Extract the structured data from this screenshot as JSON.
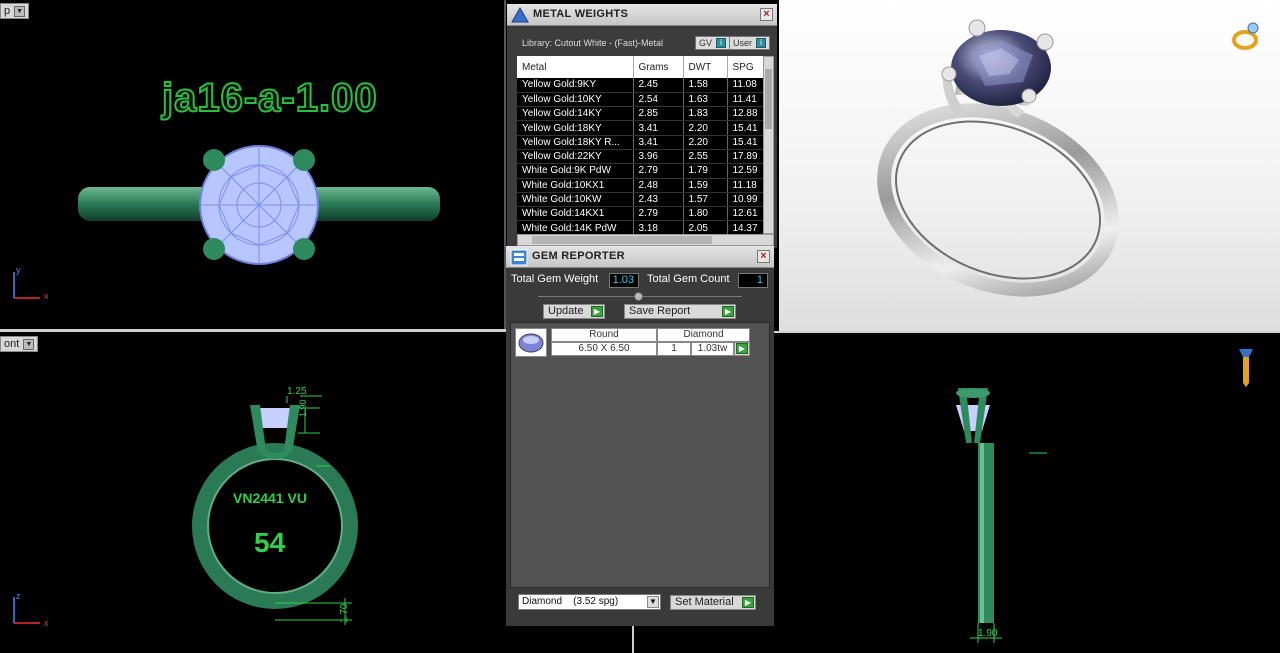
{
  "viewports": {
    "top": {
      "label": "Top",
      "label_visible": "p",
      "model_name": "ja16-a-1.00"
    },
    "front": {
      "label": "Front",
      "label_visible": "ont",
      "engraving_code": "VN2441 VU",
      "ring_size": "54",
      "dim_top": "1.25",
      "dim_side": "1.90",
      "dim_bottom": "1.70"
    },
    "right": {
      "dim_shank": "1.90"
    },
    "axes": {
      "x": "x",
      "y": "y",
      "z": "z"
    }
  },
  "metal_weights": {
    "title": "METAL WEIGHTS",
    "library": "Library: Cutout White - (Fast)-Metal",
    "toggle_gv": "GV",
    "toggle_user": "User",
    "columns": [
      "Metal",
      "Grams",
      "DWT",
      "SPG"
    ],
    "rows": [
      [
        "Yellow Gold:9KY",
        "2.45",
        "1.58",
        "11.08"
      ],
      [
        "Yellow Gold:10KY",
        "2.54",
        "1.63",
        "11.41"
      ],
      [
        "Yellow Gold:14KY",
        "2.85",
        "1.83",
        "12.88"
      ],
      [
        "Yellow Gold:18KY",
        "3.41",
        "2.20",
        "15.41"
      ],
      [
        "Yellow Gold:18KY R...",
        "3.41",
        "2.20",
        "15.41"
      ],
      [
        "Yellow Gold:22KY",
        "3.96",
        "2.55",
        "17.89"
      ],
      [
        "White Gold:9K PdW",
        "2.79",
        "1.79",
        "12.59"
      ],
      [
        "White Gold:10KX1",
        "2.48",
        "1.59",
        "11.18"
      ],
      [
        "White Gold:10KW",
        "2.43",
        "1.57",
        "10.99"
      ],
      [
        "White Gold:14KX1",
        "2.79",
        "1.80",
        "12.61"
      ],
      [
        "White Gold:14K PdW",
        "3.18",
        "2.05",
        "14.37"
      ]
    ]
  },
  "gem_reporter": {
    "title": "GEM REPORTER",
    "total_weight_label": "Total Gem Weight",
    "total_weight_value": "1.03",
    "total_count_label": "Total Gem Count",
    "total_count_value": "1",
    "update_label": "Update",
    "save_label": "Save Report",
    "gem": {
      "shape": "Round",
      "material": "Diamond",
      "size": "6.50 X 6.50",
      "count": "1",
      "carat": "1.03tw"
    },
    "material_select": "Diamond",
    "material_spg": "(3.52 spg)",
    "set_material_label": "Set Material"
  }
}
